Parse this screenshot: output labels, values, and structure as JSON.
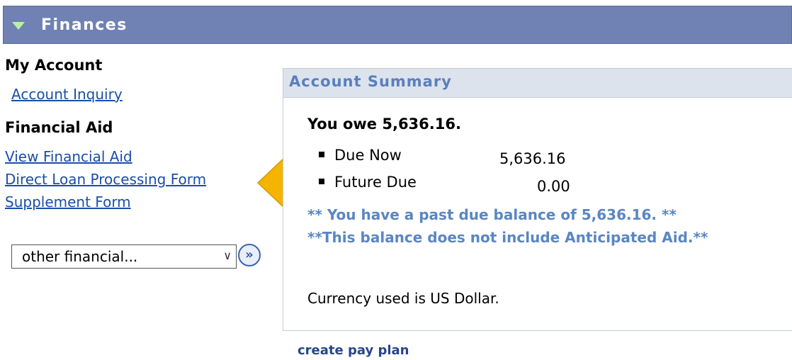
{
  "header": {
    "title": "Finances",
    "toggle_icon": "triangle-down-icon"
  },
  "left": {
    "my_account_heading": "My Account",
    "account_inquiry_link": "Account Inquiry",
    "financial_aid_heading": "Financial Aid",
    "links": [
      "View Financial Aid",
      "Direct Loan Processing Form",
      "Supplement Form"
    ],
    "dropdown_value": "other financial...",
    "go_button_icon": "double-chevron-right-icon"
  },
  "summary": {
    "title": "Account Summary",
    "owe_text": "You owe 5,636.16.",
    "items": [
      {
        "label": "Due Now",
        "amount": "5,636.16"
      },
      {
        "label": "Future Due",
        "amount": "0.00"
      }
    ],
    "notices": [
      "** You have a past due balance of 5,636.16. **",
      "**This balance does not include Anticipated Aid.**"
    ],
    "currency_text": "Currency used is US Dollar."
  },
  "footer": {
    "pay_plan_link": "create pay plan"
  },
  "colors": {
    "header_bg": "#6f82b3",
    "link": "#1a4ea8",
    "notice": "#5a86c2",
    "arrow": "#f5b400"
  }
}
